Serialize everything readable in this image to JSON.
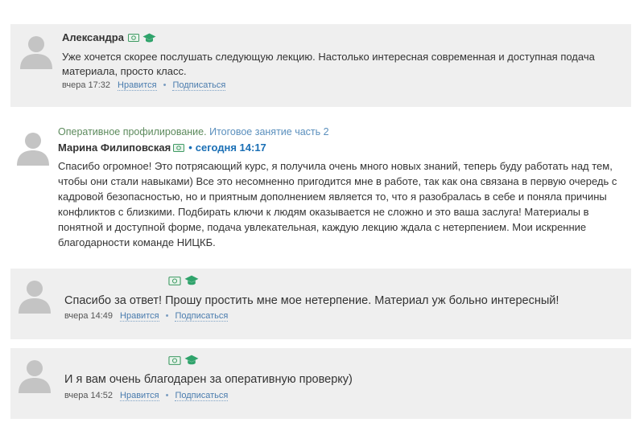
{
  "comments": [
    {
      "author": "Александра",
      "lines": [
        "Уже хочется скорее послушать следующую лекцию. Настолько интересная современная и доступная подача",
        "материала, просто класс."
      ],
      "time": "вчера 17:32",
      "like": "Нравится",
      "separator": "•",
      "subscribe": "Подписаться"
    },
    {
      "topic_course": "Оперативное профилирование.",
      "topic_lesson": "Итоговое занятие часть 2",
      "author": "Марина Филиповская",
      "dot": "•",
      "time": "сегодня 14:17",
      "lines": [
        "Спасибо огромное! Это потрясающий курс, я получила очень много новых знаний, теперь буду работать над тем,",
        "чтобы они стали навыками) Все это несомненно пригодится мне в работе, так как она связана в первую очередь с",
        "кадровой безопасностью, но и приятным дополнением является то, что я разобралась в себе и поняла причины",
        "конфликтов с близкими. Подбирать ключи к людям оказывается не сложно и это ваша заслуга! Материалы в",
        "понятной и доступной форме, подача увлекательная, каждую лекцию ждала с нетерпением. Мои искренние",
        "благодарности команде НИЦКБ."
      ]
    },
    {
      "author": "",
      "lines": [
        "Спасибо за ответ! Прошу простить мне мое нетерпение. Материал уж больно интересный!"
      ],
      "time": "вчера 14:49",
      "like": "Нравится",
      "separator": "•",
      "subscribe": "Подписаться"
    },
    {
      "author": "",
      "lines": [
        "И я вам очень благодарен за оперативную проверку)"
      ],
      "time": "вчера 14:52",
      "like": "Нравится",
      "separator": "•",
      "subscribe": "Подписаться"
    }
  ],
  "icons": {
    "avatar": "user-silhouette-icon",
    "money_badge": "money-badge-icon",
    "graduate_badge": "graduation-cap-icon"
  },
  "colors": {
    "block_bg": "#efefef",
    "link": "#4a7cae",
    "badge_green": "#2fa36b",
    "timestamp_blue": "#1a6fb5"
  }
}
